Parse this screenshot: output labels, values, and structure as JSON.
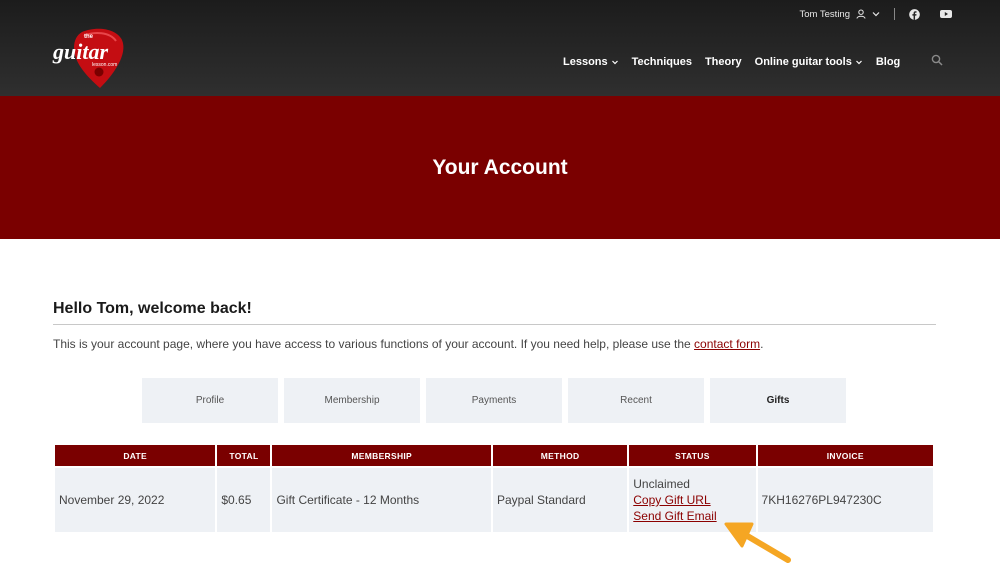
{
  "header": {
    "user_name": "Tom Testing",
    "nav": [
      "Lessons",
      "Techniques",
      "Theory",
      "Online guitar tools",
      "Blog"
    ],
    "logo_top": "the",
    "logo_main": "guitar",
    "logo_sub": "lesson.com"
  },
  "hero": {
    "title": "Your Account"
  },
  "account": {
    "welcome": "Hello Tom, welcome back!",
    "intro_text": "This is your account page, where you have access to various functions of your account. If you need help, please use the ",
    "contact_link": "contact form",
    "intro_end": "."
  },
  "tabs": [
    "Profile",
    "Membership",
    "Payments",
    "Recent",
    "Gifts"
  ],
  "table": {
    "headers": [
      "DATE",
      "TOTAL",
      "MEMBERSHIP",
      "METHOD",
      "STATUS",
      "INVOICE"
    ],
    "row": {
      "date": "November 29, 2022",
      "total": "$0.65",
      "membership": "Gift Certificate - 12 Months",
      "method": "Paypal Standard",
      "status": "Unclaimed",
      "copy_link": "Copy Gift URL",
      "send_link": "Send Gift Email",
      "invoice": "7KH16276PL947230C"
    }
  },
  "colors": {
    "brand": "#7a0000",
    "accent_arrow": "#f5a623",
    "tab_bg": "#eef1f5"
  },
  "icons": [
    "user-icon",
    "chevron-down-icon",
    "facebook-icon",
    "youtube-icon",
    "search-icon",
    "arrow-icon"
  ]
}
